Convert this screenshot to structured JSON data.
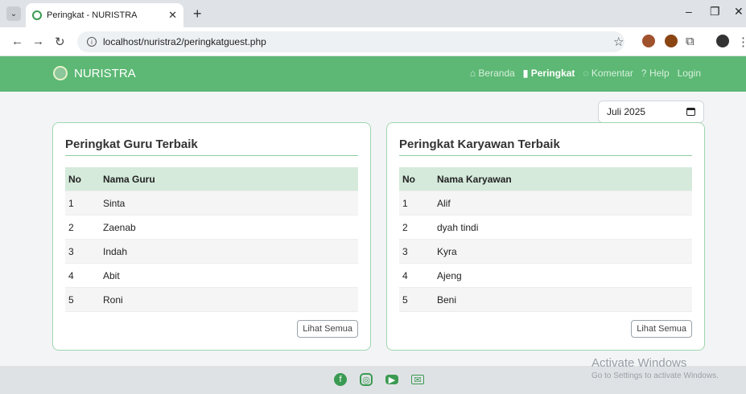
{
  "browser": {
    "tab_title": "Peringkat - NURISTRA",
    "url": "localhost/nuristra2/peringkatguest.php"
  },
  "navbar": {
    "brand": "NURISTRA",
    "links": [
      {
        "label": "Beranda",
        "active": false
      },
      {
        "label": "Peringkat",
        "active": true
      },
      {
        "label": "Komentar",
        "active": false
      },
      {
        "label": "Help",
        "active": false
      },
      {
        "label": "Login",
        "active": false
      }
    ]
  },
  "date_filter": {
    "value": "Juli 2025"
  },
  "guru_card": {
    "title": "Peringkat Guru Terbaik",
    "columns": [
      "No",
      "Nama Guru"
    ],
    "rows": [
      {
        "no": "1",
        "name": "Sinta"
      },
      {
        "no": "2",
        "name": "Zaenab"
      },
      {
        "no": "3",
        "name": "Indah"
      },
      {
        "no": "4",
        "name": "Abit"
      },
      {
        "no": "5",
        "name": "Roni"
      }
    ],
    "button": "Lihat Semua"
  },
  "karyawan_card": {
    "title": "Peringkat Karyawan Terbaik",
    "columns": [
      "No",
      "Nama Karyawan"
    ],
    "rows": [
      {
        "no": "1",
        "name": "Alif"
      },
      {
        "no": "2",
        "name": "dyah tindi"
      },
      {
        "no": "3",
        "name": "Kyra"
      },
      {
        "no": "4",
        "name": "Ajeng"
      },
      {
        "no": "5",
        "name": "Beni"
      }
    ],
    "button": "Lihat Semua"
  },
  "watermark": {
    "line1": "Activate Windows",
    "line2": "Go to Settings to activate Windows."
  },
  "colors": {
    "primary": "#5cb874",
    "table_head": "#d5eadb",
    "card_border": "#9ed7ae"
  }
}
